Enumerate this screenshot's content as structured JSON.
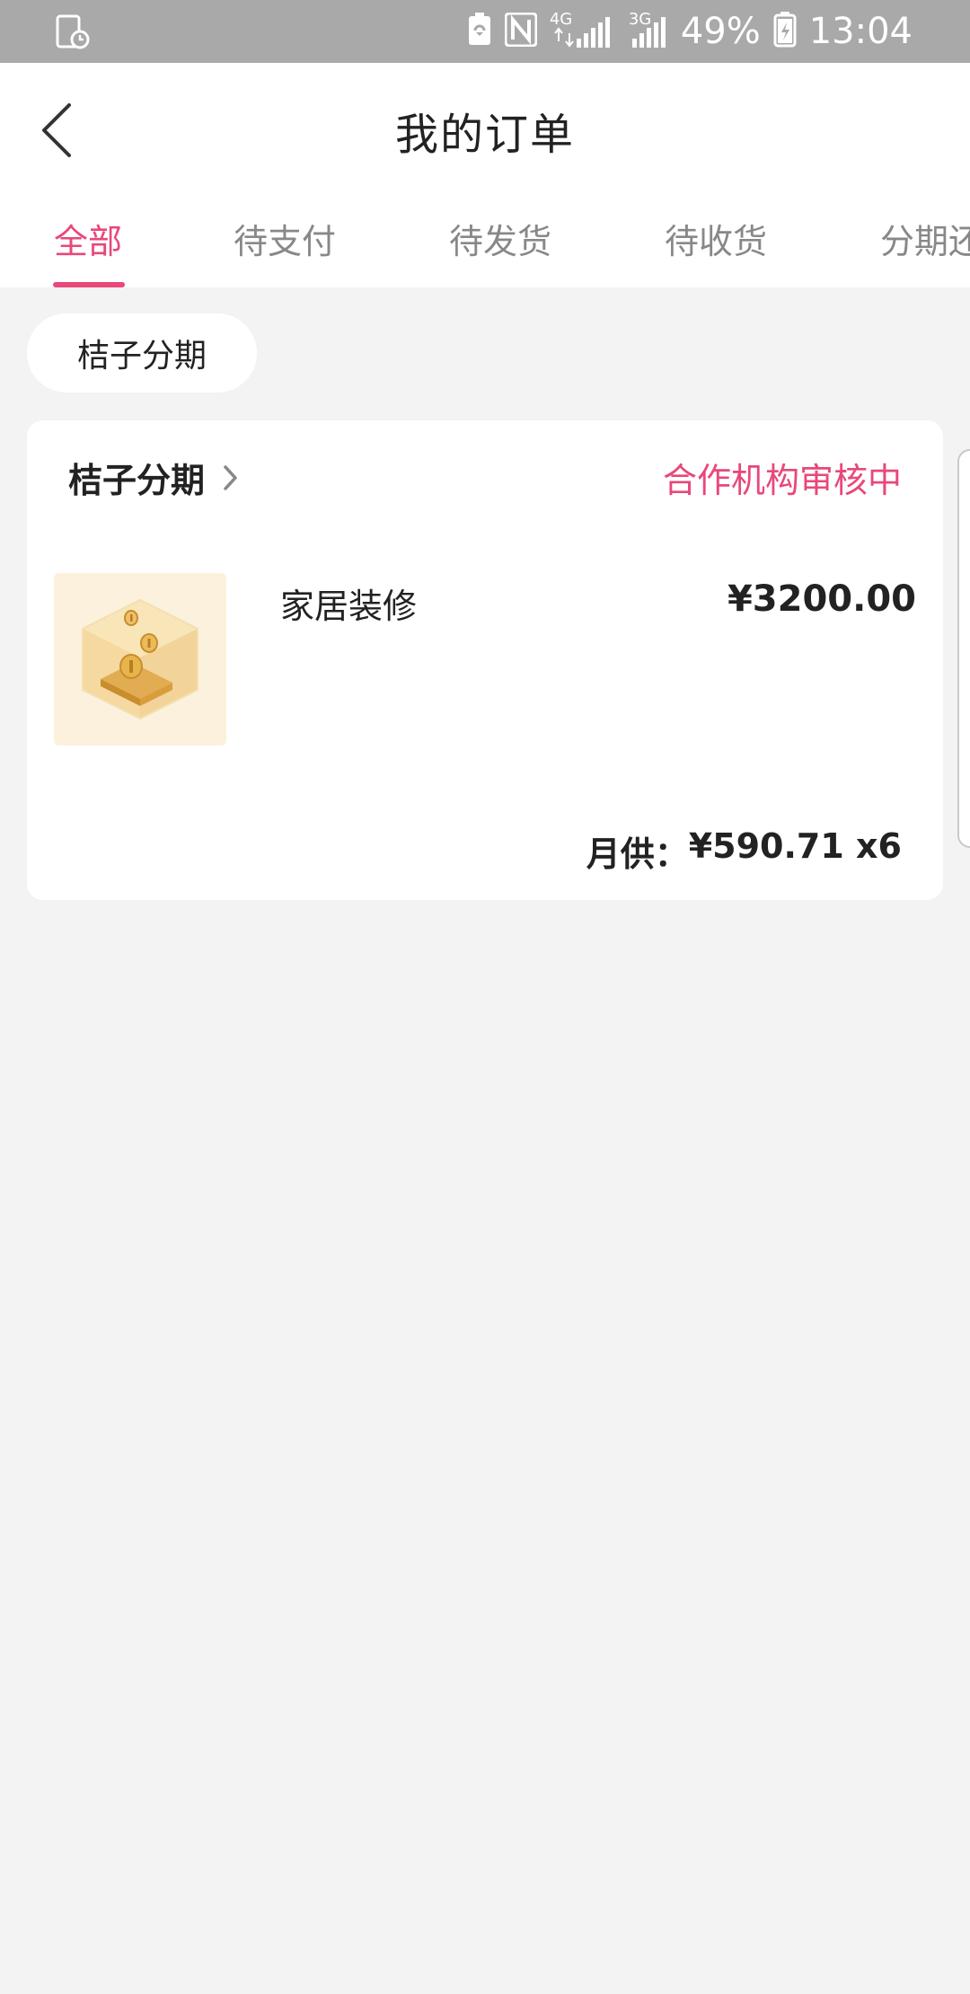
{
  "status_bar": {
    "battery_percent": "49%",
    "time": "13:04",
    "network_4g": "4G",
    "network_3g": "3G",
    "icons": [
      "screen-timer-icon",
      "battery-saver-icon",
      "nfc-icon",
      "signal-4g-icon",
      "signal-3g-icon",
      "battery-icon"
    ]
  },
  "header": {
    "title": "我的订单",
    "back_icon": "back-arrow-icon"
  },
  "tabs": [
    {
      "label": "全部",
      "active": true
    },
    {
      "label": "待支付",
      "active": false
    },
    {
      "label": "待发货",
      "active": false
    },
    {
      "label": "待收货",
      "active": false
    },
    {
      "label": "分期还",
      "active": false
    }
  ],
  "filter_chip": {
    "label": "桔子分期"
  },
  "order": {
    "store_name": "桔子分期",
    "status": "合作机构审核中",
    "product_name": "家居装修",
    "price": "¥3200.00",
    "monthly_label": "月供：",
    "monthly_amount": "¥590.71",
    "monthly_terms": " x6"
  },
  "colors": {
    "accent": "#e8487a",
    "background": "#f3f3f3",
    "status_bar": "#a9a9a9"
  }
}
